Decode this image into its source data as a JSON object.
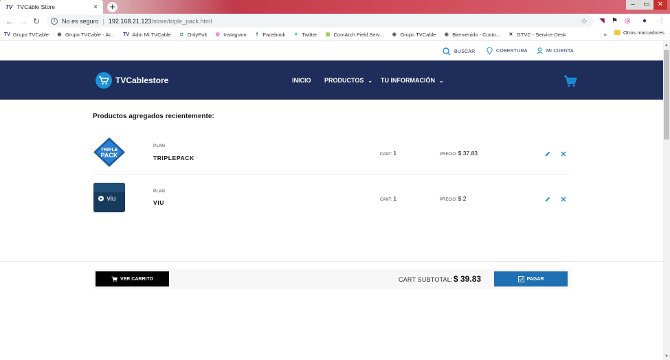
{
  "browser": {
    "tab_title": "TVCable Store",
    "tab_favicon_text": "TV",
    "security_label": "No es seguro",
    "url_host": "192.168.21.123",
    "url_path": "/store/triple_pack.html",
    "bookmarks": [
      {
        "label": "Grupo TVCable",
        "icon": "TV",
        "color": "#1d3a8a"
      },
      {
        "label": "Grupo TVCable - Ac...",
        "icon": "◉",
        "color": "#555"
      },
      {
        "label": "Adm Mi TVCable",
        "icon": "TV",
        "color": "#1d3a8a"
      },
      {
        "label": "OnlyPult",
        "icon": "◘",
        "color": "#2aa36b"
      },
      {
        "label": "Instagram",
        "icon": "◎",
        "color": "#d6249f"
      },
      {
        "label": "Facebook",
        "icon": "f",
        "color": "#3b5998"
      },
      {
        "label": "Twitter",
        "icon": "✦",
        "color": "#1da1f2"
      },
      {
        "label": "ComArch Field Serv...",
        "icon": "▣",
        "color": "#8cc63f"
      },
      {
        "label": "Grupo TVCable",
        "icon": "◉",
        "color": "#555"
      },
      {
        "label": "Bienvenido - Custo...",
        "icon": "◉",
        "color": "#555"
      },
      {
        "label": "GTVC - Service Desk",
        "icon": "✕",
        "color": "#333"
      }
    ],
    "more_bookmarks": "»",
    "other_bookmarks": "Otros marcadores"
  },
  "utility": {
    "search": "BUSCAR",
    "coverage": "COBERTURA",
    "account": "MI CUENTA"
  },
  "nav": {
    "brand": "TVCablestore",
    "items": [
      {
        "label": "INICIO",
        "dropdown": false
      },
      {
        "label": "PRODUCTOS",
        "dropdown": true
      },
      {
        "label": "TU INFORMACIÓN",
        "dropdown": true
      }
    ],
    "colors": {
      "nav_bg": "#1e2d5a",
      "accent": "#1b8fd8"
    }
  },
  "cart": {
    "heading": "Productos agregados recientemente:",
    "items": [
      {
        "type_label": "PLAN",
        "name": "TRIPLEPACK",
        "qty_label": "CANT:",
        "qty": "1",
        "price_label": "PRECIO:",
        "price": "$ 37.83",
        "image_text_1": "TRIPLE",
        "image_text_2": "PACK"
      },
      {
        "type_label": "PLAN",
        "name": "VIU",
        "qty_label": "CANT:",
        "qty": "1",
        "price_label": "PRECIO:",
        "price": "$ 2",
        "image_text_1": "viu"
      }
    ],
    "view_cart_label": "VER CARRITO",
    "subtotal_label": "CART SUBTOTAL:",
    "subtotal_value": "$ 39.83",
    "pay_label": "PAGAR"
  }
}
